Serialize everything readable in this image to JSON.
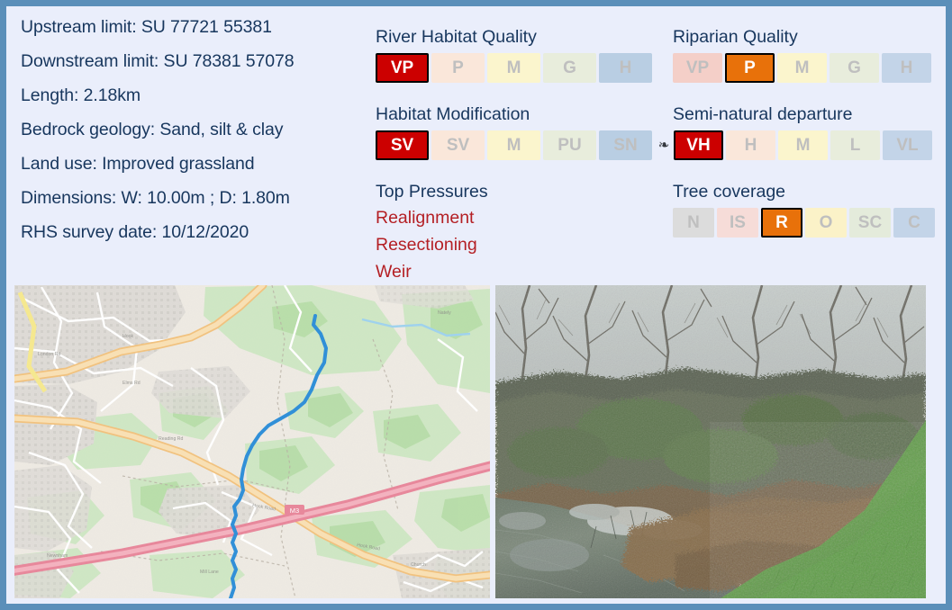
{
  "card": {
    "border_color": "#5b8fb9",
    "background_color": "#eaeefb",
    "heading_color": "#17365d",
    "pressure_color": "#b41f24",
    "active_red": "#cc0000",
    "active_orange": "#e8710a"
  },
  "info": {
    "lines": [
      "Upstream limit: SU 77721 55381",
      "Downstream limit: SU 78381 57078",
      "Length: 2.18km",
      "Bedrock geology: Sand, silt & clay",
      "Land use: Improved grassland",
      "Dimensions: W: 10.00m ; D: 1.80m",
      "RHS survey date: 10/12/2020"
    ]
  },
  "panels": {
    "river_habitat_quality": {
      "title": "River Habitat Quality",
      "cells": [
        {
          "label": "VP",
          "active": true,
          "color": "red",
          "bg": "#f9dcd0"
        },
        {
          "label": "P",
          "active": false,
          "color": "",
          "bg": "#fae7da"
        },
        {
          "label": "M",
          "active": false,
          "color": "",
          "bg": "#fbf5cd"
        },
        {
          "label": "G",
          "active": false,
          "color": "",
          "bg": "#e8eddc"
        },
        {
          "label": "H",
          "active": false,
          "color": "",
          "bg": "#b9cee3"
        }
      ]
    },
    "riparian_quality": {
      "title": "Riparian Quality",
      "cells": [
        {
          "label": "VP",
          "active": false,
          "color": "",
          "bg": "#f4cfc8"
        },
        {
          "label": "P",
          "active": true,
          "color": "orange",
          "bg": "#fae7da"
        },
        {
          "label": "M",
          "active": false,
          "color": "",
          "bg": "#fbf5cd"
        },
        {
          "label": "G",
          "active": false,
          "color": "",
          "bg": "#e8eddc"
        },
        {
          "label": "H",
          "active": false,
          "color": "",
          "bg": "#c3d4e8"
        }
      ]
    },
    "habitat_modification": {
      "title": "Habitat Modification",
      "cells": [
        {
          "label": "SV",
          "active": true,
          "color": "red",
          "bg": "#f9dcd0"
        },
        {
          "label": "SV",
          "active": false,
          "color": "",
          "bg": "#fae7da"
        },
        {
          "label": "M",
          "active": false,
          "color": "",
          "bg": "#fbf5cd"
        },
        {
          "label": "PU",
          "active": false,
          "color": "",
          "bg": "#e8eddc"
        },
        {
          "label": "SN",
          "active": false,
          "color": "",
          "bg": "#b9cee3"
        }
      ]
    },
    "semi_natural_departure": {
      "title": "Semi-natural departure",
      "glyph": "❧",
      "cells": [
        {
          "label": "VH",
          "active": true,
          "color": "red",
          "bg": "#f9dcd0"
        },
        {
          "label": "H",
          "active": false,
          "color": "",
          "bg": "#fae7da"
        },
        {
          "label": "M",
          "active": false,
          "color": "",
          "bg": "#fbf5cd"
        },
        {
          "label": "L",
          "active": false,
          "color": "",
          "bg": "#e8eddc"
        },
        {
          "label": "VL",
          "active": false,
          "color": "",
          "bg": "#c3d4e8"
        }
      ]
    },
    "tree_coverage": {
      "title": "Tree coverage",
      "cells": [
        {
          "label": "N",
          "active": false,
          "color": "",
          "bg": "#dcdcdc"
        },
        {
          "label": "IS",
          "active": false,
          "color": "",
          "bg": "#f6dcd8"
        },
        {
          "label": "R",
          "active": true,
          "color": "orange",
          "bg": "#fae7da"
        },
        {
          "label": "O",
          "active": false,
          "color": "",
          "bg": "#fbf2c8"
        },
        {
          "label": "SC",
          "active": false,
          "color": "",
          "bg": "#e4ebdb"
        },
        {
          "label": "C",
          "active": false,
          "color": "",
          "bg": "#c3d4e8"
        }
      ]
    },
    "top_pressures": {
      "title": "Top Pressures",
      "items": [
        "Realignment",
        "Resectioning",
        "Weir"
      ]
    }
  },
  "media": {
    "map": {
      "name": "location-map",
      "description": "Street map showing river course in blue running north-south, motorway M3 in pink crossing south-east, town roads in orange and green parkland"
    },
    "photo": {
      "name": "river-photograph",
      "description": "Winter photograph of river channel with dense bare scrub on far bank, brown dead vegetation and mown green grass in foreground"
    }
  }
}
